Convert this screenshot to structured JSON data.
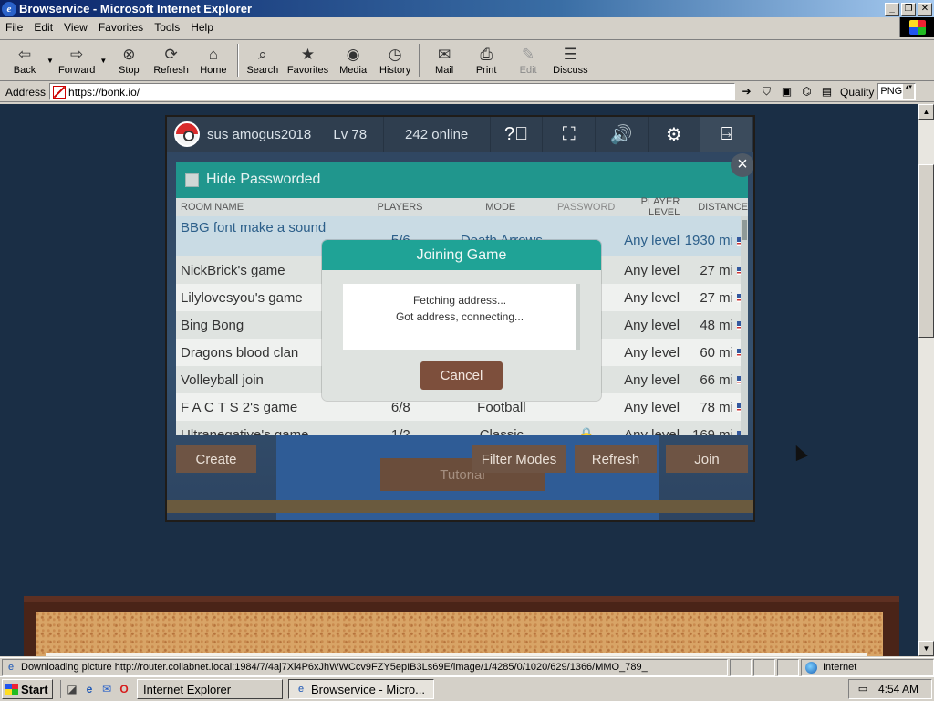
{
  "window": {
    "title": "Browservice - Microsoft Internet Explorer",
    "minimize": "_",
    "restore": "❐",
    "close": "✕"
  },
  "menu": [
    "File",
    "Edit",
    "View",
    "Favorites",
    "Tools",
    "Help"
  ],
  "toolbar": {
    "back": "Back",
    "forward": "Forward",
    "stop": "Stop",
    "refresh": "Refresh",
    "home": "Home",
    "search": "Search",
    "favorites": "Favorites",
    "media": "Media",
    "history": "History",
    "mail": "Mail",
    "print": "Print",
    "edit": "Edit",
    "discuss": "Discuss"
  },
  "address": {
    "label": "Address",
    "url": "https://bonk.io/",
    "quality_label": "Quality",
    "quality_value": "PNG"
  },
  "game": {
    "username": "sus amogus2018",
    "level": "Lv 78",
    "online": "242 online",
    "hide_passworded": "Hide Passworded",
    "columns": {
      "name": "ROOM NAME",
      "players": "PLAYERS",
      "mode": "MODE",
      "password": "PASSWORD",
      "level": "PLAYER LEVEL",
      "distance": "DISTANCE"
    },
    "rooms": [
      {
        "name": "BBG font make a sound",
        "players": "5/6",
        "mode": "Death Arrows",
        "password": "",
        "level": "Any level",
        "distance": "1930 mi"
      },
      {
        "name": "NickBrick's game",
        "players": "",
        "mode": "",
        "password": "",
        "level": "Any level",
        "distance": "27 mi"
      },
      {
        "name": "Lilylovesyou's game",
        "players": "",
        "mode": "",
        "password": "",
        "level": "Any level",
        "distance": "27 mi"
      },
      {
        "name": "Bing Bong",
        "players": "",
        "mode": "",
        "password": "",
        "level": "Any level",
        "distance": "48 mi"
      },
      {
        "name": "Dragons blood clan",
        "players": "",
        "mode": "",
        "password": "",
        "level": "Any level",
        "distance": "60 mi"
      },
      {
        "name": "Volleyball join",
        "players": "",
        "mode": "",
        "password": "",
        "level": "Any level",
        "distance": "66 mi"
      },
      {
        "name": "F A C T S 2's game",
        "players": "6/8",
        "mode": "Football",
        "password": "",
        "level": "Any level",
        "distance": "78 mi"
      },
      {
        "name": "Ultranegative's game",
        "players": "1/2",
        "mode": "Classic",
        "password": "🔒",
        "level": "Any level",
        "distance": "169 mi"
      }
    ],
    "buttons": {
      "create": "Create",
      "filter": "Filter Modes",
      "refresh": "Refresh",
      "join": "Join",
      "tutorial": "Tutorial"
    },
    "dialog": {
      "title": "Joining Game",
      "line1": "Fetching address...",
      "line2": "Got address, connecting...",
      "cancel": "Cancel"
    }
  },
  "status": {
    "text": "Downloading picture http://router.collabnet.local:1984/7/4aj7Xl4P6xJhWWCcv9FZY5epIB3Ls69E/image/1/4285/0/1020/629/1366/MMO_789_",
    "zone": "Internet"
  },
  "taskbar": {
    "start": "Start",
    "tasks": [
      "Internet Explorer",
      "Browservice - Micro..."
    ],
    "time": "4:54 AM"
  },
  "colors": {
    "teal": "#20968d",
    "brown_button": "#6e5444",
    "page_bg": "#1a2e45",
    "win_gray": "#d4d0c8"
  }
}
